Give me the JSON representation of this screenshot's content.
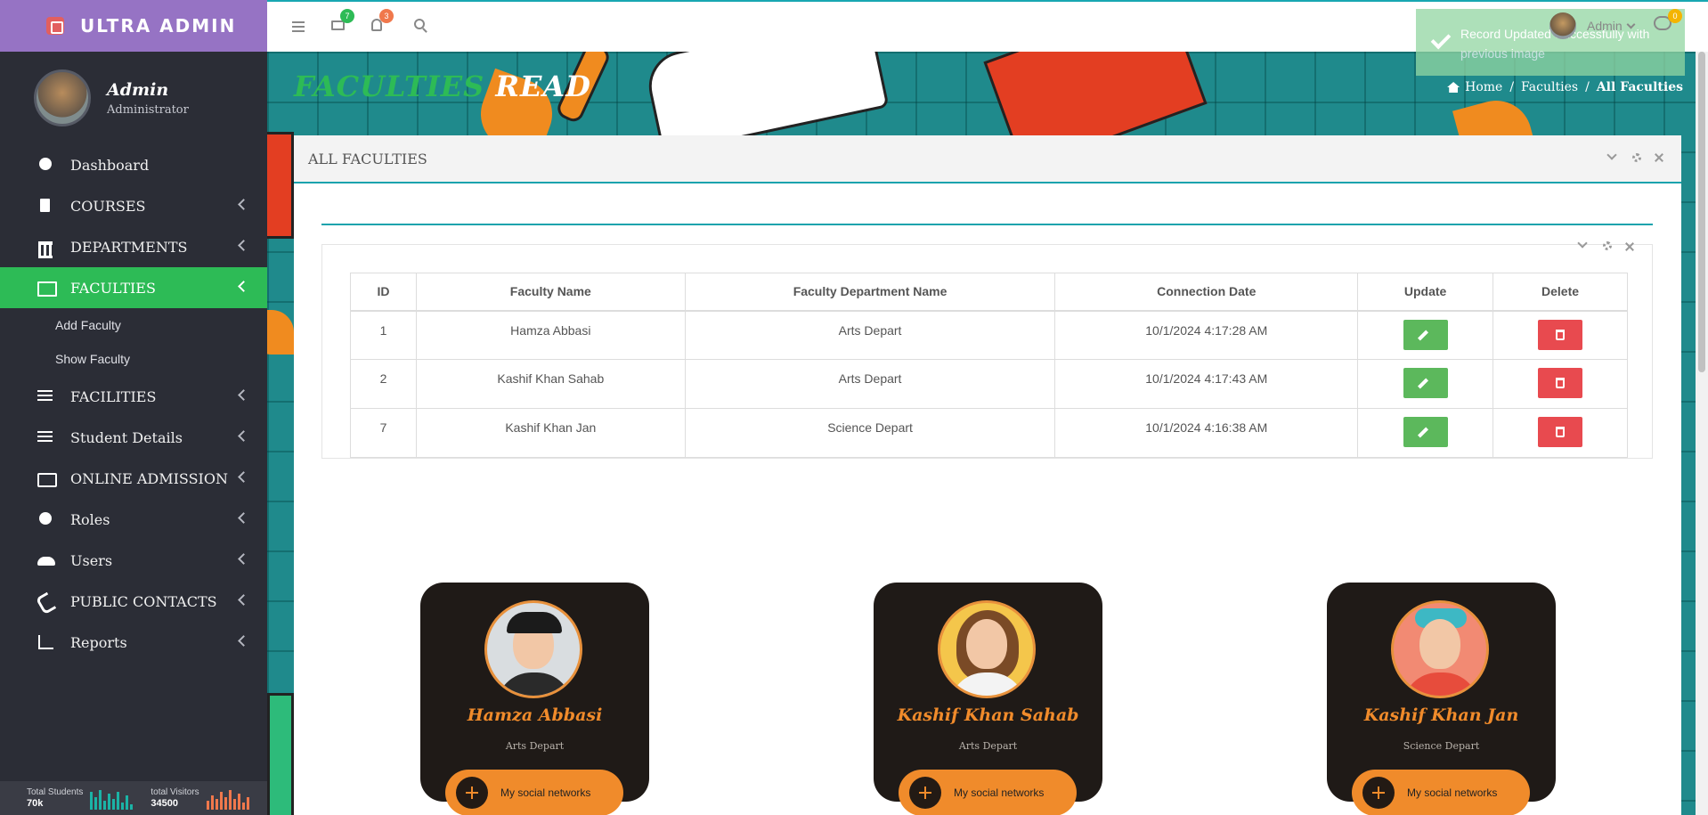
{
  "brand": {
    "name": "ULTRA ADMIN"
  },
  "profile": {
    "name": "Admin",
    "role": "Administrator"
  },
  "sidebar": {
    "items": [
      {
        "label": "Dashboard",
        "icon": "dashboard-icon"
      },
      {
        "label": "COURSES",
        "icon": "book-icon"
      },
      {
        "label": "DEPARTMENTS",
        "icon": "bank-icon"
      },
      {
        "label": "FACULTIES",
        "icon": "teacher-icon",
        "active": true
      },
      {
        "label": "FACILITIES",
        "icon": "list-icon"
      },
      {
        "label": "Student Details",
        "icon": "list-icon"
      },
      {
        "label": "ONLINE ADMISSION",
        "icon": "id-card-icon"
      },
      {
        "label": "Roles",
        "icon": "user-circle-icon"
      },
      {
        "label": "Users",
        "icon": "users-icon"
      },
      {
        "label": "PUBLIC CONTACTS",
        "icon": "phone-icon"
      },
      {
        "label": "Reports",
        "icon": "bar-chart-icon"
      }
    ],
    "subitems": [
      "Add Faculty",
      "Show Faculty"
    ],
    "footer": {
      "students_label": "Total Students",
      "students_value": "70k",
      "visitors_label": "total Visitors",
      "visitors_value": "34500"
    }
  },
  "topbar": {
    "mail_badge": "7",
    "notif_badge": "3",
    "user_name": "Admin",
    "chat_badge": "0"
  },
  "toast": {
    "message": "Record Updated Successfully with previous image"
  },
  "page": {
    "title_part1": "FACULTIES",
    "title_part2": "READ",
    "breadcrumb": [
      "Home",
      "Faculties",
      "All Faculties"
    ]
  },
  "panel": {
    "title": "ALL FACULTIES"
  },
  "table": {
    "headers": [
      "ID",
      "Faculty Name",
      "Faculty Department Name",
      "Connection Date",
      "Update",
      "Delete"
    ],
    "rows": [
      {
        "id": "1",
        "name": "Hamza Abbasi",
        "dept": "Arts Depart",
        "date": "10/1/2024 4:17:28 AM"
      },
      {
        "id": "2",
        "name": "Kashif Khan Sahab",
        "dept": "Arts Depart",
        "date": "10/1/2024 4:17:43 AM"
      },
      {
        "id": "7",
        "name": "Kashif Khan Jan",
        "dept": "Science Depart",
        "date": "10/1/2024 4:16:38 AM"
      }
    ]
  },
  "cards": [
    {
      "name": "Hamza Abbasi",
      "dept": "Arts Depart",
      "social": "My social networks"
    },
    {
      "name": "Kashif Khan Sahab",
      "dept": "Arts Depart",
      "social": "My social networks"
    },
    {
      "name": "Kashif Khan Jan",
      "dept": "Science Depart",
      "social": "My social networks"
    }
  ],
  "colors": {
    "accent": "#2dbb56",
    "brand": "#9673c4",
    "teal": "#1aa3ad",
    "card_orange": "#f08b2b"
  }
}
